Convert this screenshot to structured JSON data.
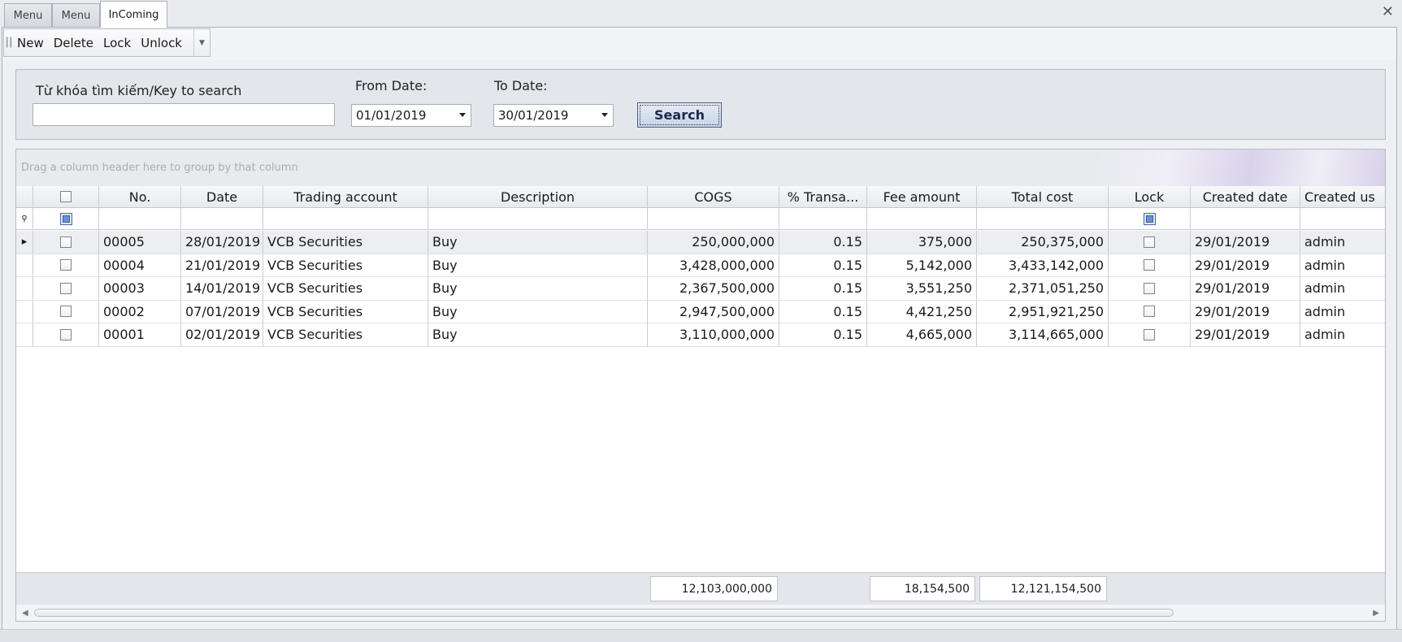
{
  "tabs": [
    {
      "label": "Menu"
    },
    {
      "label": "Menu"
    },
    {
      "label": "InComing"
    }
  ],
  "window": {
    "close_glyph": "✕"
  },
  "toolbar": {
    "new": "New",
    "delete": "Delete",
    "lock": "Lock",
    "unlock": "Unlock"
  },
  "search": {
    "keyword_label": "Từ khóa tìm kiếm/Key to search",
    "keyword_value": "",
    "from_label": "From Date:",
    "from_value": "01/01/2019",
    "to_label": "To Date:",
    "to_value": "30/01/2019",
    "button": "Search"
  },
  "grid": {
    "group_hint": "Drag a column header here to group by that column",
    "columns": {
      "no": "No.",
      "date": "Date",
      "account": "Trading account",
      "description": "Description",
      "cogs": "COGS",
      "pct": "% Transa...",
      "fee": "Fee amount",
      "total": "Total cost",
      "lock": "Lock",
      "created_date": "Created date",
      "created_user": "Created us"
    },
    "rows": [
      {
        "no": "00005",
        "date": "28/01/2019",
        "account": "VCB Securities",
        "description": "Buy",
        "cogs": "250,000,000",
        "pct": "0.15",
        "fee": "375,000",
        "total": "250,375,000",
        "created_date": "29/01/2019",
        "created_user": "admin"
      },
      {
        "no": "00004",
        "date": "21/01/2019",
        "account": "VCB Securities",
        "description": "Buy",
        "cogs": "3,428,000,000",
        "pct": "0.15",
        "fee": "5,142,000",
        "total": "3,433,142,000",
        "created_date": "29/01/2019",
        "created_user": "admin"
      },
      {
        "no": "00003",
        "date": "14/01/2019",
        "account": "VCB Securities",
        "description": "Buy",
        "cogs": "2,367,500,000",
        "pct": "0.15",
        "fee": "3,551,250",
        "total": "2,371,051,250",
        "created_date": "29/01/2019",
        "created_user": "admin"
      },
      {
        "no": "00002",
        "date": "07/01/2019",
        "account": "VCB Securities",
        "description": "Buy",
        "cogs": "2,947,500,000",
        "pct": "0.15",
        "fee": "4,421,250",
        "total": "2,951,921,250",
        "created_date": "29/01/2019",
        "created_user": "admin"
      },
      {
        "no": "00001",
        "date": "02/01/2019",
        "account": "VCB Securities",
        "description": "Buy",
        "cogs": "3,110,000,000",
        "pct": "0.15",
        "fee": "4,665,000",
        "total": "3,114,665,000",
        "created_date": "29/01/2019",
        "created_user": "admin"
      }
    ],
    "totals": {
      "cogs": "12,103,000,000",
      "fee": "18,154,500",
      "total": "12,121,154,500"
    }
  }
}
